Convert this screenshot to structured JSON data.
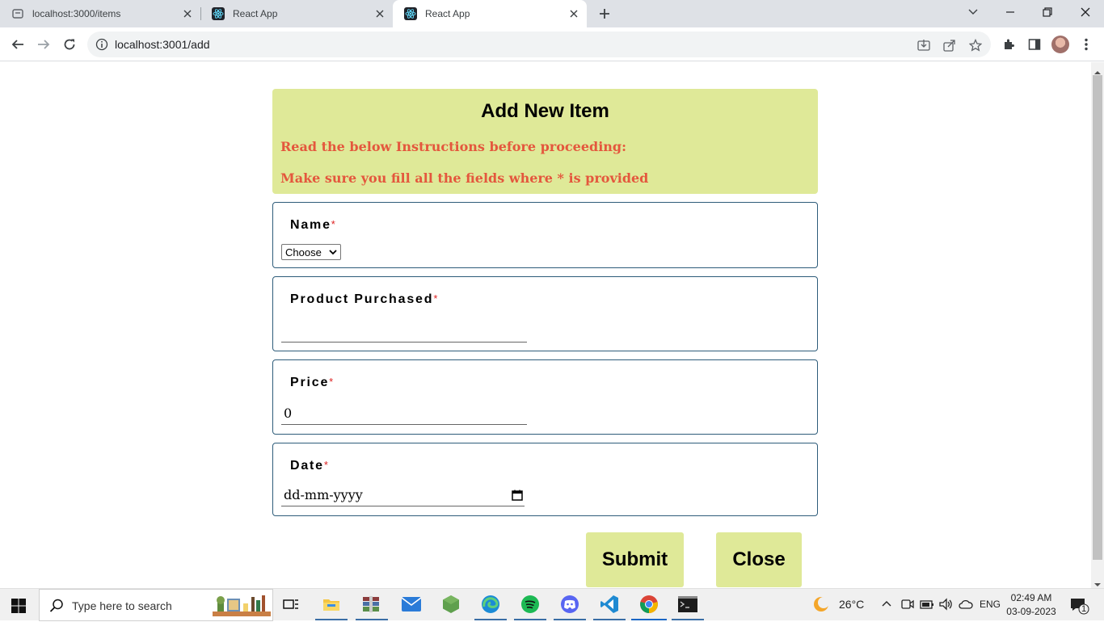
{
  "browser": {
    "tabs": [
      {
        "title": "localhost:3000/items",
        "active": false
      },
      {
        "title": "React App",
        "active": false
      },
      {
        "title": "React App",
        "active": true
      }
    ],
    "url": "localhost:3001/add"
  },
  "page": {
    "heading": "Add New Item",
    "instructions": [
      "Read the below Instructions before proceeding:",
      "Make sure you fill all the fields where * is provided"
    ],
    "fields": {
      "name": {
        "label": "Name",
        "required_mark": "*",
        "select_value": "Choose"
      },
      "product": {
        "label": "Product Purchased",
        "required_mark": "*",
        "value": ""
      },
      "price": {
        "label": "Price",
        "required_mark": "*",
        "value": "0"
      },
      "date": {
        "label": "Date",
        "required_mark": "*",
        "placeholder": "dd-mm-yyyy"
      }
    },
    "buttons": {
      "submit": "Submit",
      "close": "Close"
    },
    "colors": {
      "accent": "#dfe998",
      "instruction_text": "#e4573d",
      "border": "#2e5c7a",
      "required": "#dd2222"
    }
  },
  "taskbar": {
    "search_placeholder": "Type here to search",
    "weather": "26°C",
    "language": "ENG",
    "time": "02:49 AM",
    "date": "03-09-2023",
    "notifications": "1",
    "apps": [
      "task-view-icon",
      "file-explorer-icon",
      "archive-icon",
      "mail-icon",
      "node-icon",
      "edge-icon",
      "spotify-icon",
      "discord-icon",
      "vscode-icon",
      "chrome-icon",
      "terminal-icon"
    ]
  }
}
